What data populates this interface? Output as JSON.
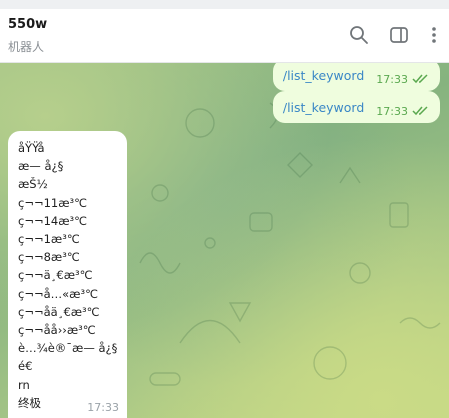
{
  "header": {
    "title": "550w",
    "subtitle": "机器人",
    "search_icon": "search-icon",
    "sidebar_icon": "sidebar-toggle-icon",
    "more_icon": "more-vertical-icon"
  },
  "messages": {
    "outgoing": [
      {
        "text": "/list_keyword",
        "time": "17:33",
        "status_icon": "double-check-icon"
      },
      {
        "text": "/list_keyword",
        "time": "17:33",
        "status_icon": "double-check-icon"
      }
    ],
    "incoming": {
      "lines": [
        "åŸŸå",
        "æ— å¿§",
        "æŠ½",
        "ç¬¬11æ³℃",
        "ç¬¬14æ³℃",
        "ç¬¬1æ³℃",
        "ç¬¬8æ³℃",
        "ç¬¬ä¸€æ³℃",
        "ç¬¬å…«æ³℃",
        "ç¬¬åä¸€æ³℃",
        "ç¬¬åå››æ³℃",
        "è…¾è®¯æ— å¿§",
        "é€",
        "rn",
        "终极"
      ],
      "time": "17:33"
    }
  },
  "colors": {
    "outgoing_bubble": "#effdde",
    "command_link": "#3a87c6",
    "check_green": "#5aa84f"
  }
}
